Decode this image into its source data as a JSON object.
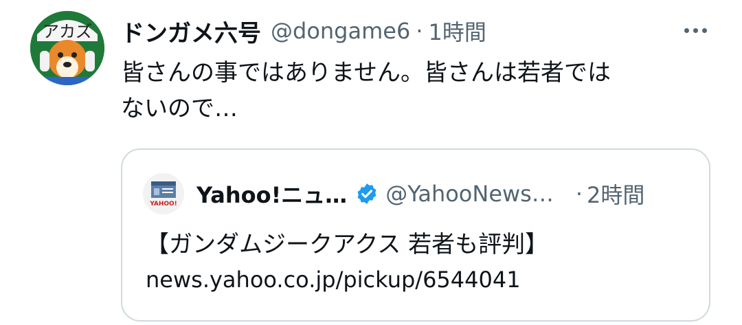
{
  "tweet": {
    "display_name": "ドンガメ六号",
    "handle": "@dongame6",
    "separator": "·",
    "time": "1時間",
    "text_line1": "皆さんの事ではありません。皆さんは若者では",
    "text_line2": "ないので…"
  },
  "quote": {
    "display_name": "Yahoo!ニュ…",
    "handle": "@YahooNews…",
    "separator": "·",
    "time": "2時間",
    "title": "【ガンダムジークアクス 若者も評判】",
    "link": "news.yahoo.co.jp/pickup/6544041"
  },
  "avatar_text": "アカズ",
  "quote_avatar_text": "YAHOO!",
  "icons": {
    "more": "more-dots-icon",
    "verified": "verified-badge-icon"
  },
  "colors": {
    "text": "#0f1419",
    "secondary": "#536471",
    "border": "#cfd9de",
    "verified": "#1d9bf0"
  }
}
